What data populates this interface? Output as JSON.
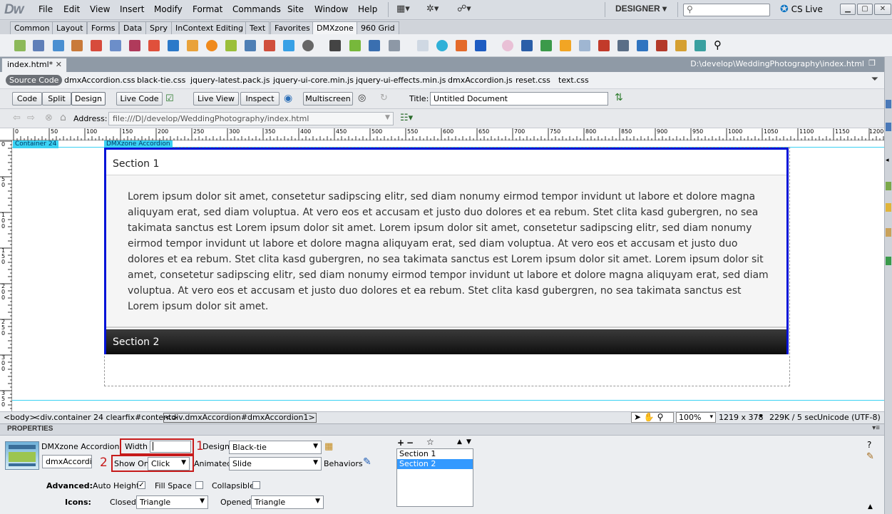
{
  "app": {
    "logo": "Dw",
    "workspace": "DESIGNER",
    "cs_live": "CS Live"
  },
  "menus": [
    "File",
    "Edit",
    "View",
    "Insert",
    "Modify",
    "Format",
    "Commands",
    "Site",
    "Window",
    "Help"
  ],
  "insert_tabs": [
    "Common",
    "Layout",
    "Forms",
    "Data",
    "Spry",
    "InContext Editing",
    "Text",
    "Favorites",
    "DMXzone",
    "960 Grid"
  ],
  "active_insert_tab": "DMXzone",
  "document": {
    "tab": "index.html*",
    "path": "D:\\develop\\WeddingPhotography\\index.html"
  },
  "related_files": [
    "Source Code",
    "dmxAccordion.css",
    "black-tie.css",
    "jquery-latest.pack.js",
    "jquery-ui-core.min.js",
    "jquery-ui-effects.min.js",
    "dmxAccordion.js",
    "reset.css",
    "text.css"
  ],
  "doc_toolbar": {
    "code": "Code",
    "split": "Split",
    "design": "Design",
    "live_code": "Live Code",
    "live_view": "Live View",
    "inspect": "Inspect",
    "multiscreen": "Multiscreen",
    "title_label": "Title:",
    "title_value": "Untitled Document"
  },
  "address": {
    "label": "Address:",
    "value": "file:///D|/develop/WeddingPhotography/index.html"
  },
  "ruler_ticks": [
    "0",
    "50",
    "100",
    "150",
    "200",
    "250",
    "300",
    "350",
    "400",
    "450",
    "500",
    "550",
    "600",
    "650",
    "700",
    "750",
    "800",
    "850",
    "900",
    "950",
    "1000",
    "1050",
    "1100",
    "1150",
    "1200"
  ],
  "vruler_ticks": [
    "0",
    "50",
    "100",
    "150",
    "200",
    "250",
    "300",
    "350"
  ],
  "canvas": {
    "container_label": "Container 24",
    "accordion_label": "DMXzone Accordion",
    "section1_title": "Section 1",
    "section1_body": "Lorem ipsum dolor sit amet, consetetur sadipscing elitr, sed diam nonumy eirmod tempor invidunt ut labore et dolore magna aliquyam erat, sed diam voluptua. At vero eos et accusam et justo duo dolores et ea rebum. Stet clita kasd gubergren, no sea takimata sanctus est Lorem ipsum dolor sit amet. Lorem ipsum dolor sit amet, consetetur sadipscing elitr, sed diam nonumy eirmod tempor invidunt ut labore et dolore magna aliquyam erat, sed diam voluptua. At vero eos et accusam et justo duo dolores et ea rebum. Stet clita kasd gubergren, no sea takimata sanctus est Lorem ipsum dolor sit amet. Lorem ipsum dolor sit amet, consetetur sadipscing elitr, sed diam nonumy eirmod tempor invidunt ut labore et dolore magna aliquyam erat, sed diam voluptua. At vero eos et accusam et justo duo dolores et ea rebum. Stet clita kasd gubergren, no sea takimata sanctus est Lorem ipsum dolor sit amet.",
    "section2_title": "Section 2"
  },
  "status": {
    "tag_body": "<body>",
    "tag_container": "<div.container  24 clearfix#content>",
    "tag_accordion": "<div.dmxAccordion#dmxAccordion1>",
    "zoom": "100%",
    "size": "1219 x 378",
    "download": "229K / 5 sec",
    "encoding": "Unicode (UTF-8)"
  },
  "properties": {
    "header": "PROPERTIES",
    "widget_name": "DMXzone Accordion",
    "id_value": "dmxAccordion",
    "width_label": "Width",
    "width_value": "",
    "annot1": "1",
    "annot2": "2",
    "design_label": "Design",
    "design_value": "Black-tie",
    "show_on_label": "Show On",
    "show_on_value": "Click",
    "animated_label": "Animated",
    "animated_value": "Slide",
    "behaviors_label": "Behaviors",
    "advanced_label": "Advanced:",
    "auto_height_label": "Auto Height",
    "auto_height_checked": true,
    "fill_space_label": "Fill Space",
    "collapsible_label": "Collapsible",
    "icons_label": "Icons:",
    "closed_label": "Closed",
    "closed_value": "Triangle",
    "opened_label": "Opened",
    "opened_value": "Triangle",
    "sections": [
      "Section 1",
      "Section 2"
    ],
    "selected_section": "Section 2"
  },
  "colors": {
    "selection_border": "#0013d8",
    "element_label": "#3bd2f3",
    "annotation": "#c61a1a",
    "section2_header": "#232323"
  }
}
